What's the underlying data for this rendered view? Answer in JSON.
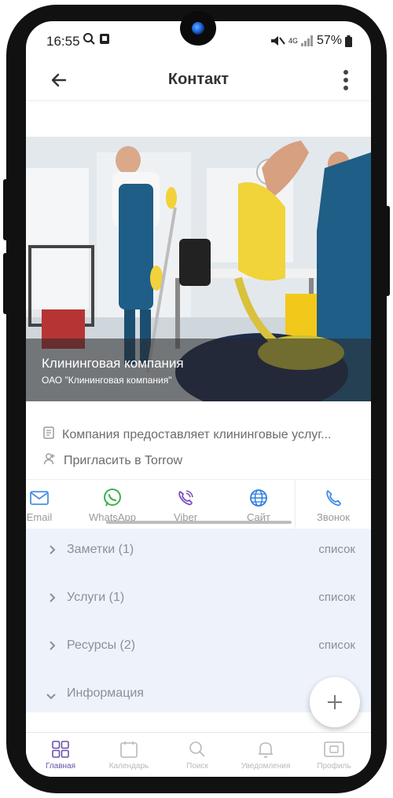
{
  "status": {
    "time": "16:55",
    "network": "4G",
    "battery": "57%"
  },
  "appbar": {
    "title": "Контакт"
  },
  "hero": {
    "name": "Клининговая компания",
    "org": "ОАО \"Клининговая компания\""
  },
  "info": {
    "description": "Компания предоставляет клининговые услуг...",
    "invite": "Пригласить в Torrow"
  },
  "actions": [
    {
      "label": "Email",
      "icon": "mail-icon",
      "color": "#4a90e2"
    },
    {
      "label": "WhatsApp",
      "icon": "whatsapp-icon",
      "color": "#3cb44a"
    },
    {
      "label": "Viber",
      "icon": "viber-icon",
      "color": "#7b4fc4"
    },
    {
      "label": "Сайт",
      "icon": "globe-icon",
      "color": "#2f7fe0"
    },
    {
      "label": "Звонок",
      "icon": "phone-icon",
      "color": "#3a8ee6"
    }
  ],
  "sections": [
    {
      "label": "Заметки (1)",
      "action": "список",
      "expanded": false
    },
    {
      "label": "Услуги (1)",
      "action": "список",
      "expanded": false
    },
    {
      "label": "Ресурсы (2)",
      "action": "список",
      "expanded": false
    },
    {
      "label": "Информация",
      "action": "",
      "expanded": true
    }
  ],
  "nav": [
    {
      "label": "Главная",
      "icon": "grid-icon",
      "active": true
    },
    {
      "label": "Календарь",
      "icon": "calendar-icon",
      "active": false
    },
    {
      "label": "Поиск",
      "icon": "search-icon",
      "active": false
    },
    {
      "label": "Уведомления",
      "icon": "bell-icon",
      "active": false
    },
    {
      "label": "Профиль",
      "icon": "profile-card-icon",
      "active": false
    }
  ],
  "colors": {
    "accent": "#6a4fa8",
    "sections_bg": "#eef3fb"
  }
}
